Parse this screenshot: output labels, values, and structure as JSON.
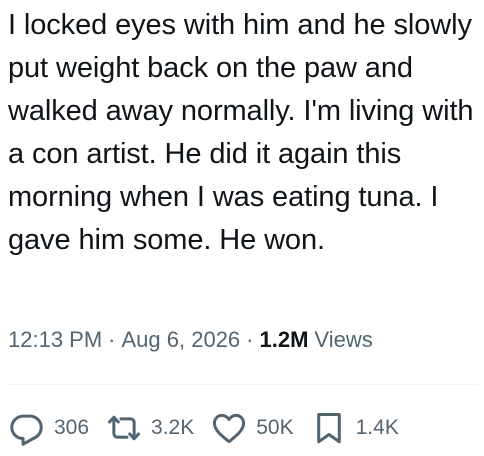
{
  "tweet": {
    "text": "I locked eyes with him and he slowly put weight back on the paw and walked away normally. I'm living with a con artist. He did it again this morning when I was eating tuna. I gave him some. He won.",
    "time": "12:13 PM",
    "separator": "·",
    "date": "Aug 6, 2026",
    "views_count": "1.2M",
    "views_label": "Views"
  },
  "actions": {
    "reply_count": "306",
    "repost_count": "3.2K",
    "like_count": "50K",
    "bookmark_count": "1.4K"
  },
  "icons": {
    "reply": "reply-icon",
    "repost": "repost-icon",
    "like": "heart-icon",
    "bookmark": "bookmark-icon"
  },
  "colors": {
    "text": "#0f1419",
    "secondary": "#536471",
    "divider": "#eff3f4"
  }
}
